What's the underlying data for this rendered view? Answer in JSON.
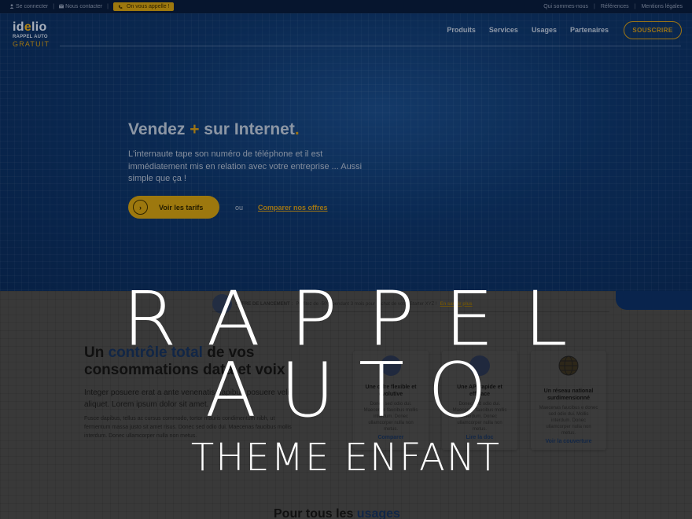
{
  "topbar": {
    "login": "Se connecter",
    "contact": "Nous contacter",
    "callback": "On vous appelle !",
    "links": [
      "Qui sommes-nous",
      "Références",
      "Mentions légales"
    ]
  },
  "logo": {
    "line1_a": "id",
    "line1_b": "e",
    "line1_c": "lio",
    "line2": "RAPPEL AUTO",
    "line3": "GRATUIT"
  },
  "nav": {
    "items": [
      "Produits",
      "Services",
      "Usages",
      "Partenaires"
    ],
    "subscribe": "SOUSCRIRE"
  },
  "hero": {
    "title_a": "Vendez ",
    "title_plus": "+",
    "title_b": " sur Internet",
    "title_dot": ".",
    "lead": "L'internaute tape son numéro de téléphone et il est immédiatement mis en relation avec votre entreprise ... Aussi simple que ça !",
    "cta": "Voir les tarifs",
    "or": "ou",
    "compare": "Comparer nos offres"
  },
  "promo": {
    "label": "OFFRE DE LANCEMENT :",
    "text": "Profitez de -50% pendant 3 mois pour l'achat de votre Starter XYZ !",
    "link": "En savoir plus"
  },
  "section": {
    "title_a": "Un ",
    "title_accent": "contrôle total",
    "title_b": " de vos consommations data et voix",
    "intro": "Integer posuere erat a ante venenatis dapibus posuere velit aliquet. Lorem ipsum dolor sit amet.",
    "body": "Fusce dapibus, tellus ac cursus commodo, tortor mauris condimentum nibh, ut fermentum massa justo sit amet risus. Donec sed odio dui. Maecenas faucibus mollis interdum. Donec ullamcorper nulla non metus."
  },
  "cards": [
    {
      "title": "Une offre flexible et évolutive",
      "body": "Donec sed odio dui. Maecenas faucibus mollis interdum. Donec ullamcorper nulla non metus.",
      "link": "Comparer",
      "icon": "offer-icon"
    },
    {
      "title": "Une API rapide et efficace",
      "body": "Donec sed odio dui. Maecenas faucibus mollis interdum. Donec ullamcorper nulla non metus.",
      "link": "Lire la doc",
      "icon": "api-icon"
    },
    {
      "title": "Un réseau national surdimensionné",
      "body": "Maecenas faucibus e donec sed odio dui. Mollis interdum. Donec ullamcorper nulla non metus.",
      "link": "Voir la couverture",
      "icon": "globe-icon"
    }
  ],
  "usage": {
    "title_a": "Pour tous les ",
    "title_accent": "usages"
  },
  "overlay": {
    "line1": "R A P P E L",
    "line2": "A U T O",
    "line3": "THEME ENFANT"
  },
  "colors": {
    "navy": "#0c2f63",
    "gold": "#c99a12",
    "white": "#ffffff"
  }
}
